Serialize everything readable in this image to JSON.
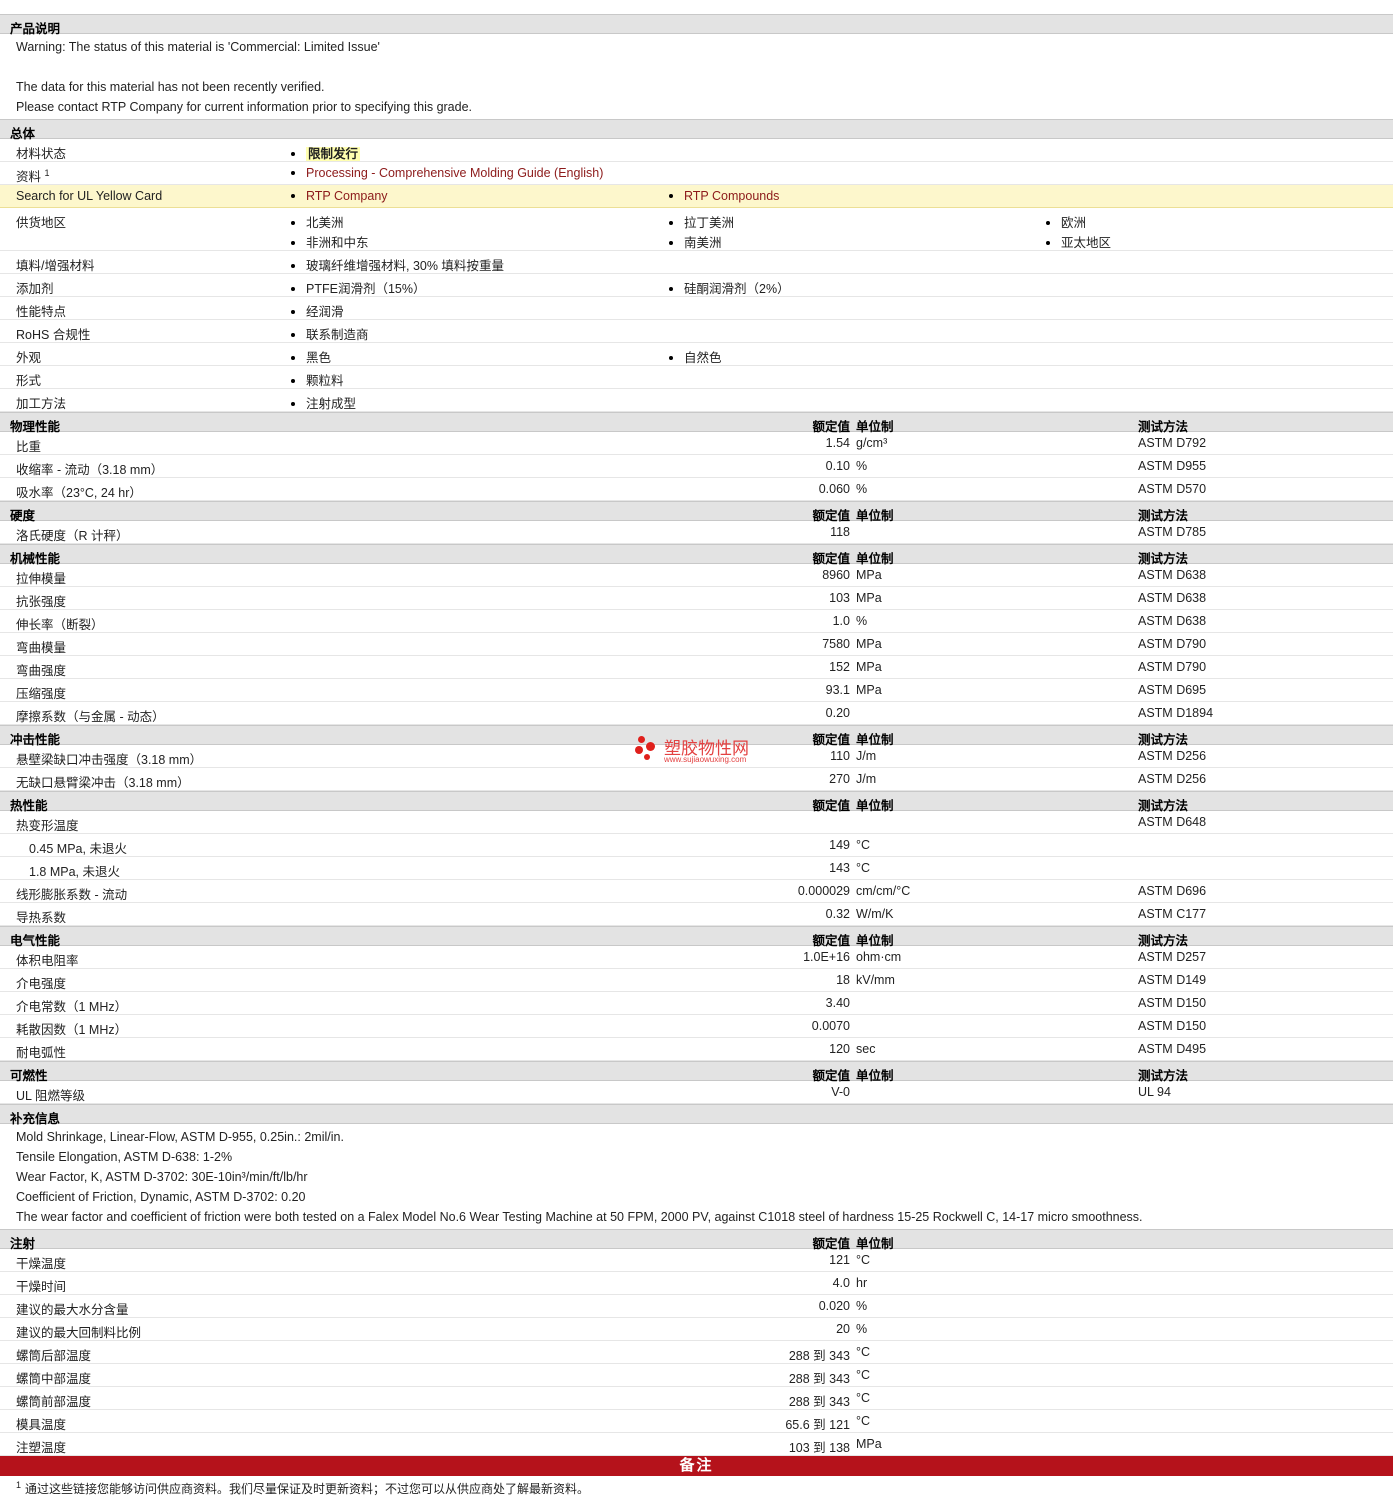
{
  "description": {
    "title": "产品说明",
    "lines": [
      "Warning: The status of this material is 'Commercial: Limited Issue'",
      "",
      "The data for this material has not been recently verified.",
      "Please contact RTP Company for current information prior to specifying this grade."
    ]
  },
  "general": {
    "title": "总体",
    "material_status": {
      "label": "材料状态",
      "value": "限制发行"
    },
    "docs": {
      "label": "资料",
      "sup": "1",
      "link": "Processing - Comprehensive Molding Guide (English)"
    },
    "ul": {
      "label": "Search for UL Yellow Card",
      "link1": "RTP Company",
      "link2": "RTP Compounds"
    },
    "regions": {
      "label": "供货地区",
      "items": [
        "北美洲",
        "拉丁美洲",
        "欧洲",
        "非洲和中东",
        "南美洲",
        "亚太地区"
      ]
    },
    "filler": {
      "label": "填料/增强材料",
      "value": "玻璃纤维增强材料, 30% 填料按重量"
    },
    "additive": {
      "label": "添加剂",
      "v1": "PTFE润滑剂（15%）",
      "v2": "硅酮润滑剂（2%）"
    },
    "features": {
      "label": "性能特点",
      "value": "经润滑"
    },
    "rohs": {
      "label": "RoHS 合规性",
      "value": "联系制造商"
    },
    "appearance": {
      "label": "外观",
      "v1": "黑色",
      "v2": "自然色"
    },
    "form": {
      "label": "形式",
      "value": "颗粒料"
    },
    "processing": {
      "label": "加工方法",
      "value": "注射成型"
    }
  },
  "headers": {
    "value": "额定值",
    "unit": "单位制",
    "method": "测试方法"
  },
  "physical": {
    "title": "物理性能",
    "rows": [
      {
        "label": "比重",
        "value": "1.54",
        "unit": "g/cm³",
        "method": "ASTM D792"
      },
      {
        "label": "收缩率 - 流动（3.18 mm）",
        "value": "0.10",
        "unit": "%",
        "method": "ASTM D955"
      },
      {
        "label": "吸水率（23°C, 24 hr）",
        "value": "0.060",
        "unit": "%",
        "method": "ASTM D570"
      }
    ]
  },
  "hardness": {
    "title": "硬度",
    "rows": [
      {
        "label": "洛氏硬度（R 计秤）",
        "value": "118",
        "unit": "",
        "method": "ASTM D785"
      }
    ]
  },
  "mechanical": {
    "title": "机械性能",
    "rows": [
      {
        "label": "拉伸模量",
        "value": "8960",
        "unit": "MPa",
        "method": "ASTM D638"
      },
      {
        "label": "抗张强度",
        "value": "103",
        "unit": "MPa",
        "method": "ASTM D638"
      },
      {
        "label": "伸长率（断裂）",
        "value": "1.0",
        "unit": "%",
        "method": "ASTM D638"
      },
      {
        "label": "弯曲模量",
        "value": "7580",
        "unit": "MPa",
        "method": "ASTM D790"
      },
      {
        "label": "弯曲强度",
        "value": "152",
        "unit": "MPa",
        "method": "ASTM D790"
      },
      {
        "label": "压缩强度",
        "value": "93.1",
        "unit": "MPa",
        "method": "ASTM D695"
      },
      {
        "label": "摩擦系数（与金属 - 动态）",
        "value": "0.20",
        "unit": "",
        "method": "ASTM D1894"
      }
    ]
  },
  "impact": {
    "title": "冲击性能",
    "rows": [
      {
        "label": "悬壁梁缺口冲击强度（3.18 mm）",
        "value": "110",
        "unit": "J/m",
        "method": "ASTM D256"
      },
      {
        "label": "无缺口悬臂梁冲击（3.18 mm）",
        "value": "270",
        "unit": "J/m",
        "method": "ASTM D256"
      }
    ]
  },
  "thermal": {
    "title": "热性能",
    "rows": [
      {
        "label": "热变形温度",
        "value": "",
        "unit": "",
        "method": "ASTM D648",
        "indent": false
      },
      {
        "label": "0.45 MPa, 未退火",
        "value": "149",
        "unit": "°C",
        "method": "",
        "indent": true
      },
      {
        "label": "1.8 MPa, 未退火",
        "value": "143",
        "unit": "°C",
        "method": "",
        "indent": true
      },
      {
        "label": "线形膨胀系数 - 流动",
        "value": "0.000029",
        "unit": "cm/cm/°C",
        "method": "ASTM D696",
        "indent": false
      },
      {
        "label": "导热系数",
        "value": "0.32",
        "unit": "W/m/K",
        "method": "ASTM C177",
        "indent": false
      }
    ]
  },
  "electrical": {
    "title": "电气性能",
    "rows": [
      {
        "label": "体积电阻率",
        "value": "1.0E+16",
        "unit": "ohm·cm",
        "method": "ASTM D257"
      },
      {
        "label": "介电强度",
        "value": "18",
        "unit": "kV/mm",
        "method": "ASTM D149"
      },
      {
        "label": "介电常数（1 MHz）",
        "value": "3.40",
        "unit": "",
        "method": "ASTM D150"
      },
      {
        "label": "耗散因数（1 MHz）",
        "value": "0.0070",
        "unit": "",
        "method": "ASTM D150"
      },
      {
        "label": "耐电弧性",
        "value": "120",
        "unit": "sec",
        "method": "ASTM D495"
      }
    ]
  },
  "flammability": {
    "title": "可燃性",
    "rows": [
      {
        "label": "UL 阻燃等级",
        "value": "V-0",
        "unit": "",
        "method": "UL 94"
      }
    ]
  },
  "supplement": {
    "title": "补充信息",
    "lines": [
      "Mold Shrinkage, Linear-Flow, ASTM D-955, 0.25in.: 2mil/in.",
      "Tensile Elongation, ASTM D-638: 1-2%",
      "Wear Factor, K, ASTM D-3702: 30E-10in³/min/ft/lb/hr",
      "Coefficient of Friction, Dynamic, ASTM D-3702: 0.20",
      "The wear factor and coefficient of friction were both tested on a Falex Model No.6 Wear Testing Machine at 50 FPM, 2000 PV, against C1018 steel of hardness 15-25 Rockwell C, 14-17 micro smoothness."
    ]
  },
  "injection": {
    "title": "注射",
    "rows": [
      {
        "label": "干燥温度",
        "value": "121",
        "unit": "°C"
      },
      {
        "label": "干燥时间",
        "value": "4.0",
        "unit": "hr"
      },
      {
        "label": "建议的最大水分含量",
        "value": "0.020",
        "unit": "%"
      },
      {
        "label": "建议的最大回制料比例",
        "value": "20",
        "unit": "%"
      },
      {
        "label": "螺筒后部温度",
        "value": "288 到  343",
        "unit": "°C"
      },
      {
        "label": "螺筒中部温度",
        "value": "288 到  343",
        "unit": "°C"
      },
      {
        "label": "螺筒前部温度",
        "value": "288 到  343",
        "unit": "°C"
      },
      {
        "label": "模具温度",
        "value": "65.6 到  121",
        "unit": "°C"
      },
      {
        "label": "注塑温度",
        "value": "103 到  138",
        "unit": "MPa"
      }
    ]
  },
  "notes": {
    "title": "备注",
    "sup": "1",
    "text": "通过这些链接您能够访问供应商资料。我们尽量保证及时更新资料；不过您可以从供应商处了解最新资料。"
  },
  "watermark": {
    "text": "塑胶物性网",
    "sub": "www.sujiaowuxing.com"
  },
  "colors": {
    "section_bg": "#e3e3e3",
    "link": "#8c1a1a",
    "highlight_row": "#fdf7cc",
    "notes_bar": "#b5121b"
  }
}
